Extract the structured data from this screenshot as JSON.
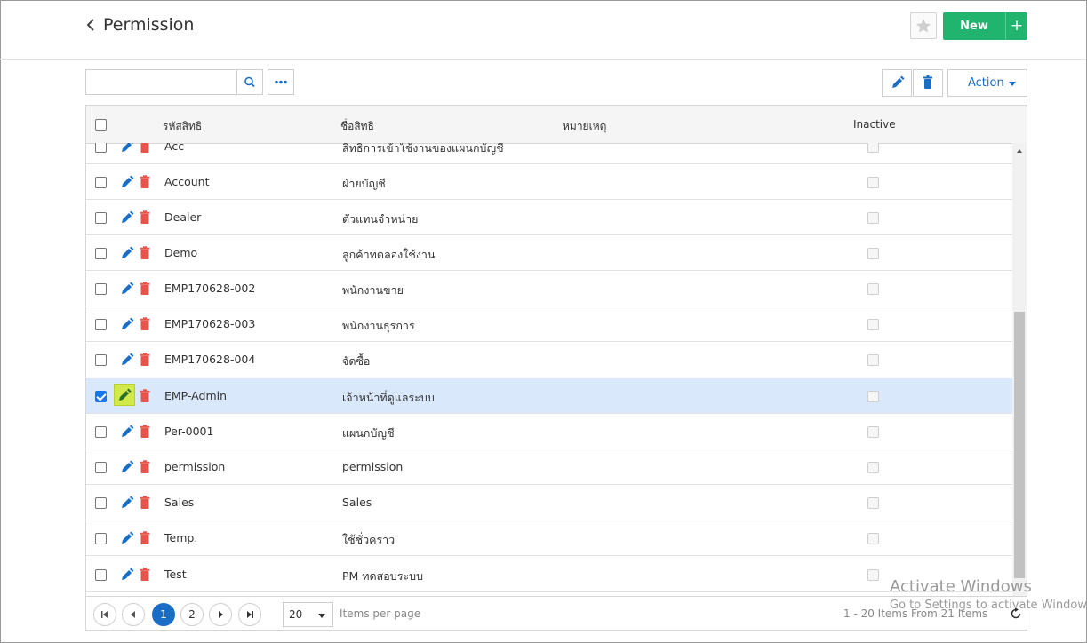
{
  "header": {
    "title": "Permission",
    "new_label": "New",
    "plus_label": "+"
  },
  "toolbar": {
    "search_value": "",
    "action_label": "Action"
  },
  "table": {
    "columns": [
      "รหัสสิทธิ",
      "ชื่อสิทธิ",
      "หมายเหตุ",
      "Inactive"
    ],
    "rows": [
      {
        "code": "Acc",
        "name": "สิทธิการเข้าใช้งานของแผนกบัญชี",
        "note": "",
        "checked": false
      },
      {
        "code": "Account",
        "name": "ฝ่ายบัญชี",
        "note": "",
        "checked": false
      },
      {
        "code": "Dealer",
        "name": "ตัวแทนจำหน่าย",
        "note": "",
        "checked": false
      },
      {
        "code": "Demo",
        "name": "ลูกค้าทดลองใช้งาน",
        "note": "",
        "checked": false
      },
      {
        "code": "EMP170628-002",
        "name": "พนักงานขาย",
        "note": "",
        "checked": false
      },
      {
        "code": "EMP170628-003",
        "name": "พนักงานธุรการ",
        "note": "",
        "checked": false
      },
      {
        "code": "EMP170628-004",
        "name": "จัดซื้อ",
        "note": "",
        "checked": false
      },
      {
        "code": "EMP-Admin",
        "name": "เจ้าหน้าที่ดูแลระบบ",
        "note": "",
        "checked": true
      },
      {
        "code": "Per-0001",
        "name": "แผนกบัญชี",
        "note": "",
        "checked": false
      },
      {
        "code": "permission",
        "name": "permission",
        "note": "",
        "checked": false
      },
      {
        "code": "Sales",
        "name": "Sales",
        "note": "",
        "checked": false
      },
      {
        "code": "Temp.",
        "name": "ใช้ชั่วคราว",
        "note": "",
        "checked": false
      },
      {
        "code": "Test",
        "name": "PM ทดสอบระบบ",
        "note": "",
        "checked": false
      }
    ]
  },
  "pagination": {
    "pages": [
      "1",
      "2"
    ],
    "current_page": "1",
    "page_size": "20",
    "items_per_page_label": "Items per page",
    "summary": "1 - 20 Items From 21 Items"
  },
  "watermark": {
    "line1": "Activate Windows",
    "line2": "Go to Settings to activate Windows."
  },
  "colors": {
    "new_button": "#21b46e",
    "edit_icon": "#1a6dc5",
    "delete_icon": "#e8534b",
    "selected_row": "#d9e8fb",
    "highlight": "#d2e94a"
  }
}
